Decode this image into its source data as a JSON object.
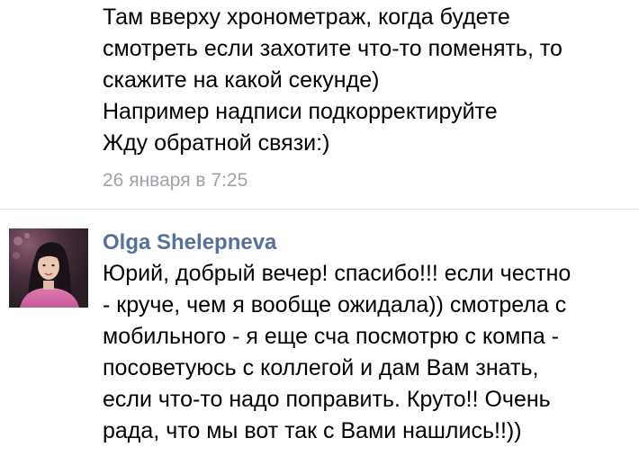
{
  "messages": [
    {
      "lines": [
        "Там вверху хронометраж, когда будете",
        "смотреть если захотите что-то поменять, то",
        "скажите на какой секунде)",
        "Например надписи подкорректируйте",
        "Жду обратной связи:)"
      ],
      "timestamp": "26 января в 7:25"
    },
    {
      "author": "Olga Shelepneva",
      "avatar_icon": "user-photo",
      "lines": [
        "Юрий, добрый вечер! спасибо!!! если честно",
        "- круче, чем я вообще ожидала)) смотрела с",
        "мобильного - я еще сча посмотрю с компа -",
        "посоветуюсь с коллегой и дам Вам знать,",
        "если что-то надо поправить. Круто!! Очень",
        "рада, что мы вот так с Вами нашлись!!))"
      ]
    }
  ],
  "colors": {
    "author_name": "#55739a",
    "timestamp": "#9ea3a8",
    "divider": "#dde1e6",
    "text": "#000000"
  }
}
